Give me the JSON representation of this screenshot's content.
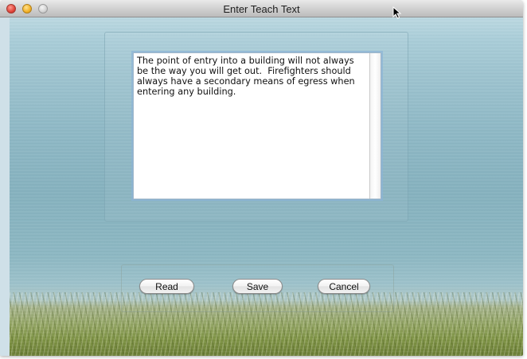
{
  "window": {
    "title": "Enter Teach Text",
    "traffic_lights": [
      "close-button",
      "minimize-button",
      "zoom-button"
    ]
  },
  "editor": {
    "text": "The point of entry into a building will not always\nbe the way you will get out.  Firefighters should\nalways have a secondary means of egress when\nentering any building."
  },
  "buttons": {
    "read": "Read",
    "save": "Save",
    "cancel": "Cancel"
  },
  "colors": {
    "close": "#e0443a",
    "minimize": "#f2b128",
    "zoom": "#d2d2d2"
  },
  "icons": {
    "cursor": "mouse-pointer-icon"
  }
}
